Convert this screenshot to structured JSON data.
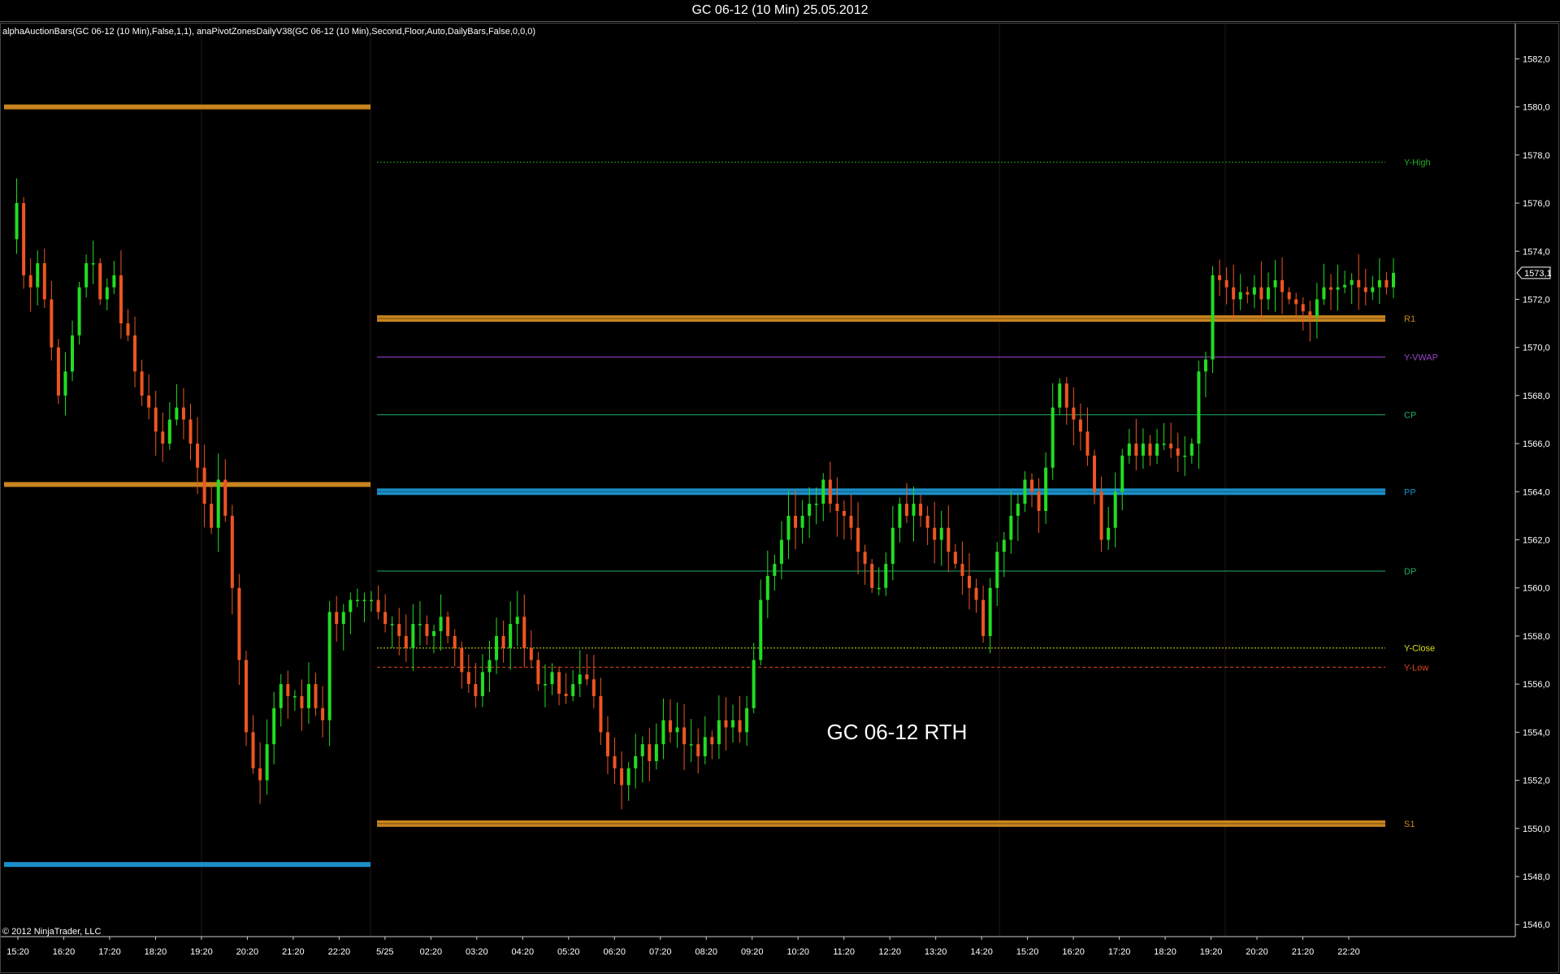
{
  "window": {
    "title": "GC 06-12 (10 Min)  25.05.2012"
  },
  "indicator_line": "alphaAuctionBars(GC 06-12 (10 Min),False,1,1), anaPivotZonesDailyV38(GC 06-12 (10 Min),Second,Floor,Auto,DailyBars,False,0,0,0)",
  "watermark": "GC 06-12 RTH",
  "copyright": "© 2012 NinjaTrader, LLC",
  "last_price_label": "1573,1",
  "colors": {
    "background": "#000000",
    "up": "#22dd22",
    "down": "#ee5522",
    "orange_zone": "#c8841e",
    "blue_zone": "#1a8fc8",
    "y_high": "#22aa22",
    "y_vwap": "#9944cc",
    "cp": "#22aa66",
    "dp": "#22aa66",
    "y_close": "#dddd22",
    "y_low": "#dd4422"
  },
  "chart_data": {
    "type": "candlestick",
    "instrument": "GC 06-12",
    "interval": "10 Min",
    "ylim": [
      1545.5,
      1583.5
    ],
    "y_ticks": [
      "1546,0",
      "1548,0",
      "1550,0",
      "1552,0",
      "1554,0",
      "1556,0",
      "1558,0",
      "1560,0",
      "1562,0",
      "1564,0",
      "1566,0",
      "1568,0",
      "1570,0",
      "1572,0",
      "1574,0",
      "1576,0",
      "1578,0",
      "1580,0",
      "1582,0"
    ],
    "x_ticks": [
      "15:20",
      "16:20",
      "17:20",
      "18:20",
      "19:20",
      "20:20",
      "21:20",
      "22:20",
      "5/25",
      "02:20",
      "03:20",
      "04:20",
      "05:20",
      "06:20",
      "07:20",
      "08:20",
      "09:20",
      "10:20",
      "11:20",
      "12:20",
      "13:20",
      "14:20",
      "15:20",
      "16:20",
      "17:20",
      "18:20",
      "19:20",
      "20:20",
      "21:20",
      "22:20"
    ],
    "prev_session_zones": [
      {
        "kind": "orange",
        "value": 1580.0
      },
      {
        "kind": "orange",
        "value": 1564.3
      },
      {
        "kind": "blue",
        "value": 1548.5
      }
    ],
    "levels": [
      {
        "label": "Y-High",
        "value": 1577.7,
        "style": "dotted",
        "color": "#22aa22"
      },
      {
        "label": "R1",
        "value": 1571.2,
        "style": "band",
        "color": "#c8841e"
      },
      {
        "label": "Y-VWAP",
        "value": 1569.6,
        "style": "solid",
        "color": "#9944cc"
      },
      {
        "label": "CP",
        "value": 1567.2,
        "style": "solid",
        "color": "#22aa66"
      },
      {
        "label": "PP",
        "value": 1564.0,
        "style": "band",
        "color": "#1a8fc8"
      },
      {
        "label": "DP",
        "value": 1560.7,
        "style": "solid",
        "color": "#22aa66"
      },
      {
        "label": "Y-Close",
        "value": 1557.5,
        "style": "dotted",
        "color": "#dddd22"
      },
      {
        "label": "Y-Low",
        "value": 1556.7,
        "style": "dashed",
        "color": "#dd4422"
      },
      {
        "label": "S1",
        "value": 1550.2,
        "style": "band",
        "color": "#c8841e"
      }
    ],
    "price_path": [
      1574.5,
      1576,
      1573,
      1572.5,
      1573.5,
      1572,
      1570,
      1568,
      1569,
      1570.5,
      1572.5,
      1573.5,
      1573.5,
      1572,
      1572.5,
      1573,
      1571,
      1570.5,
      1569,
      1568,
      1567.5,
      1566.5,
      1566,
      1567,
      1567.5,
      1567,
      1566,
      1565,
      1563.5,
      1562.5,
      1564.5,
      1563,
      1560,
      1557,
      1554,
      1552.5,
      1552,
      1553.5,
      1555,
      1556,
      1555.5,
      1555.5,
      1555,
      1556,
      1555,
      1554.5,
      1559,
      1558.5,
      1559,
      1559.5,
      1559.5,
      1559.5,
      1559.5,
      1559,
      1558.5,
      1558.5,
      1558,
      1557.5,
      1558.5,
      1558.5,
      1558,
      1558.2,
      1558.8,
      1558,
      1557.5,
      1556.5,
      1556,
      1555.5,
      1556.5,
      1557,
      1558,
      1557.5,
      1558.5,
      1558.8,
      1557.5,
      1557,
      1556,
      1556,
      1556.5,
      1555.6,
      1555.5,
      1556,
      1556.4,
      1556.2,
      1555.5,
      1554,
      1553,
      1552.5,
      1551.8,
      1552.5,
      1553,
      1553.5,
      1552.8,
      1553.5,
      1554.5,
      1554,
      1554.2,
      1553.5,
      1553.5,
      1553,
      1553.8,
      1553.5,
      1554.5,
      1554.2,
      1554.5,
      1554,
      1555,
      1557,
      1559.5,
      1560.5,
      1561,
      1562,
      1563,
      1562.5,
      1563,
      1563.5,
      1563.5,
      1564.5,
      1563.5,
      1563.2,
      1563,
      1562.5,
      1561.5,
      1561,
      1560,
      1560,
      1561,
      1562.5,
      1563.5,
      1563,
      1563.5,
      1563,
      1562.5,
      1562,
      1562.5,
      1561.5,
      1561,
      1560.5,
      1560,
      1559.5,
      1558,
      1560,
      1561.5,
      1562,
      1563,
      1563.5,
      1564.5,
      1564,
      1563.2,
      1565,
      1567.5,
      1568.5,
      1567.5,
      1567,
      1566.5,
      1565.5,
      1564,
      1562,
      1562.5,
      1564,
      1565.5,
      1566,
      1565.5,
      1566,
      1565.5,
      1566,
      1566,
      1565.8,
      1565.5,
      1565.5,
      1566,
      1569,
      1569.5,
      1573,
      1572.8,
      1572.5,
      1572,
      1572.3,
      1572.2,
      1572.5,
      1572,
      1572.5,
      1572.8,
      1572.3,
      1572,
      1571.8,
      1571.5,
      1571.3,
      1572,
      1572.5,
      1572.4,
      1572.5,
      1572.6,
      1572.8,
      1572.5,
      1572.3,
      1572.5,
      1572.8,
      1572.5,
      1573.1
    ]
  }
}
